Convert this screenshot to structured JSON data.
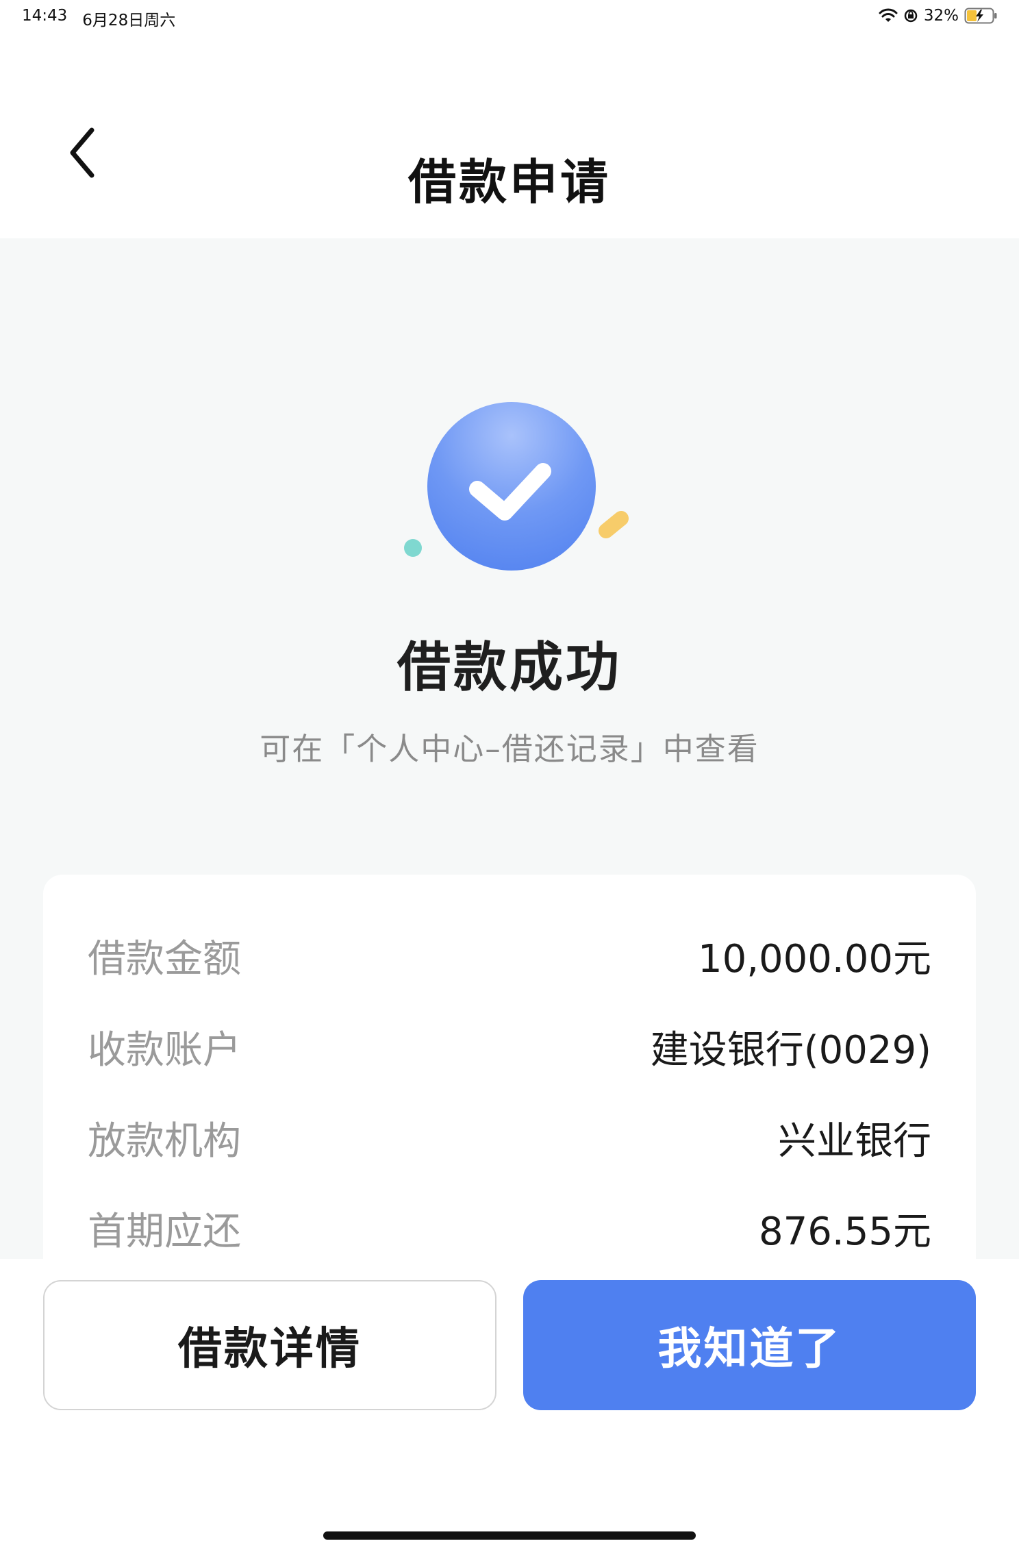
{
  "status_bar": {
    "time": "14:43",
    "date": "6月28日周六",
    "battery_percent": "32%",
    "icons": [
      "wifi-icon",
      "orientation-lock-icon",
      "battery-charging-icon"
    ]
  },
  "nav": {
    "title": "借款申请",
    "back_icon": "chevron-left-icon"
  },
  "result": {
    "icon": "check-circle-icon",
    "title": "借款成功",
    "subtitle": "可在「个人中心–借还记录」中查看"
  },
  "details": [
    {
      "label": "借款金额",
      "value": "10,000.00元"
    },
    {
      "label": "收款账户",
      "value": "建设银行(0029)"
    },
    {
      "label": "放款机构",
      "value": "兴业银行"
    },
    {
      "label": "首期应还",
      "value": "876.55元"
    }
  ],
  "buttons": {
    "detail_label": "借款详情",
    "ok_label": "我知道了"
  },
  "colors": {
    "accent": "#4f80f0",
    "page_background": "#f6f8f8",
    "teal_dot": "#7fd8d0",
    "yellow_dash": "#f7cc6a"
  }
}
